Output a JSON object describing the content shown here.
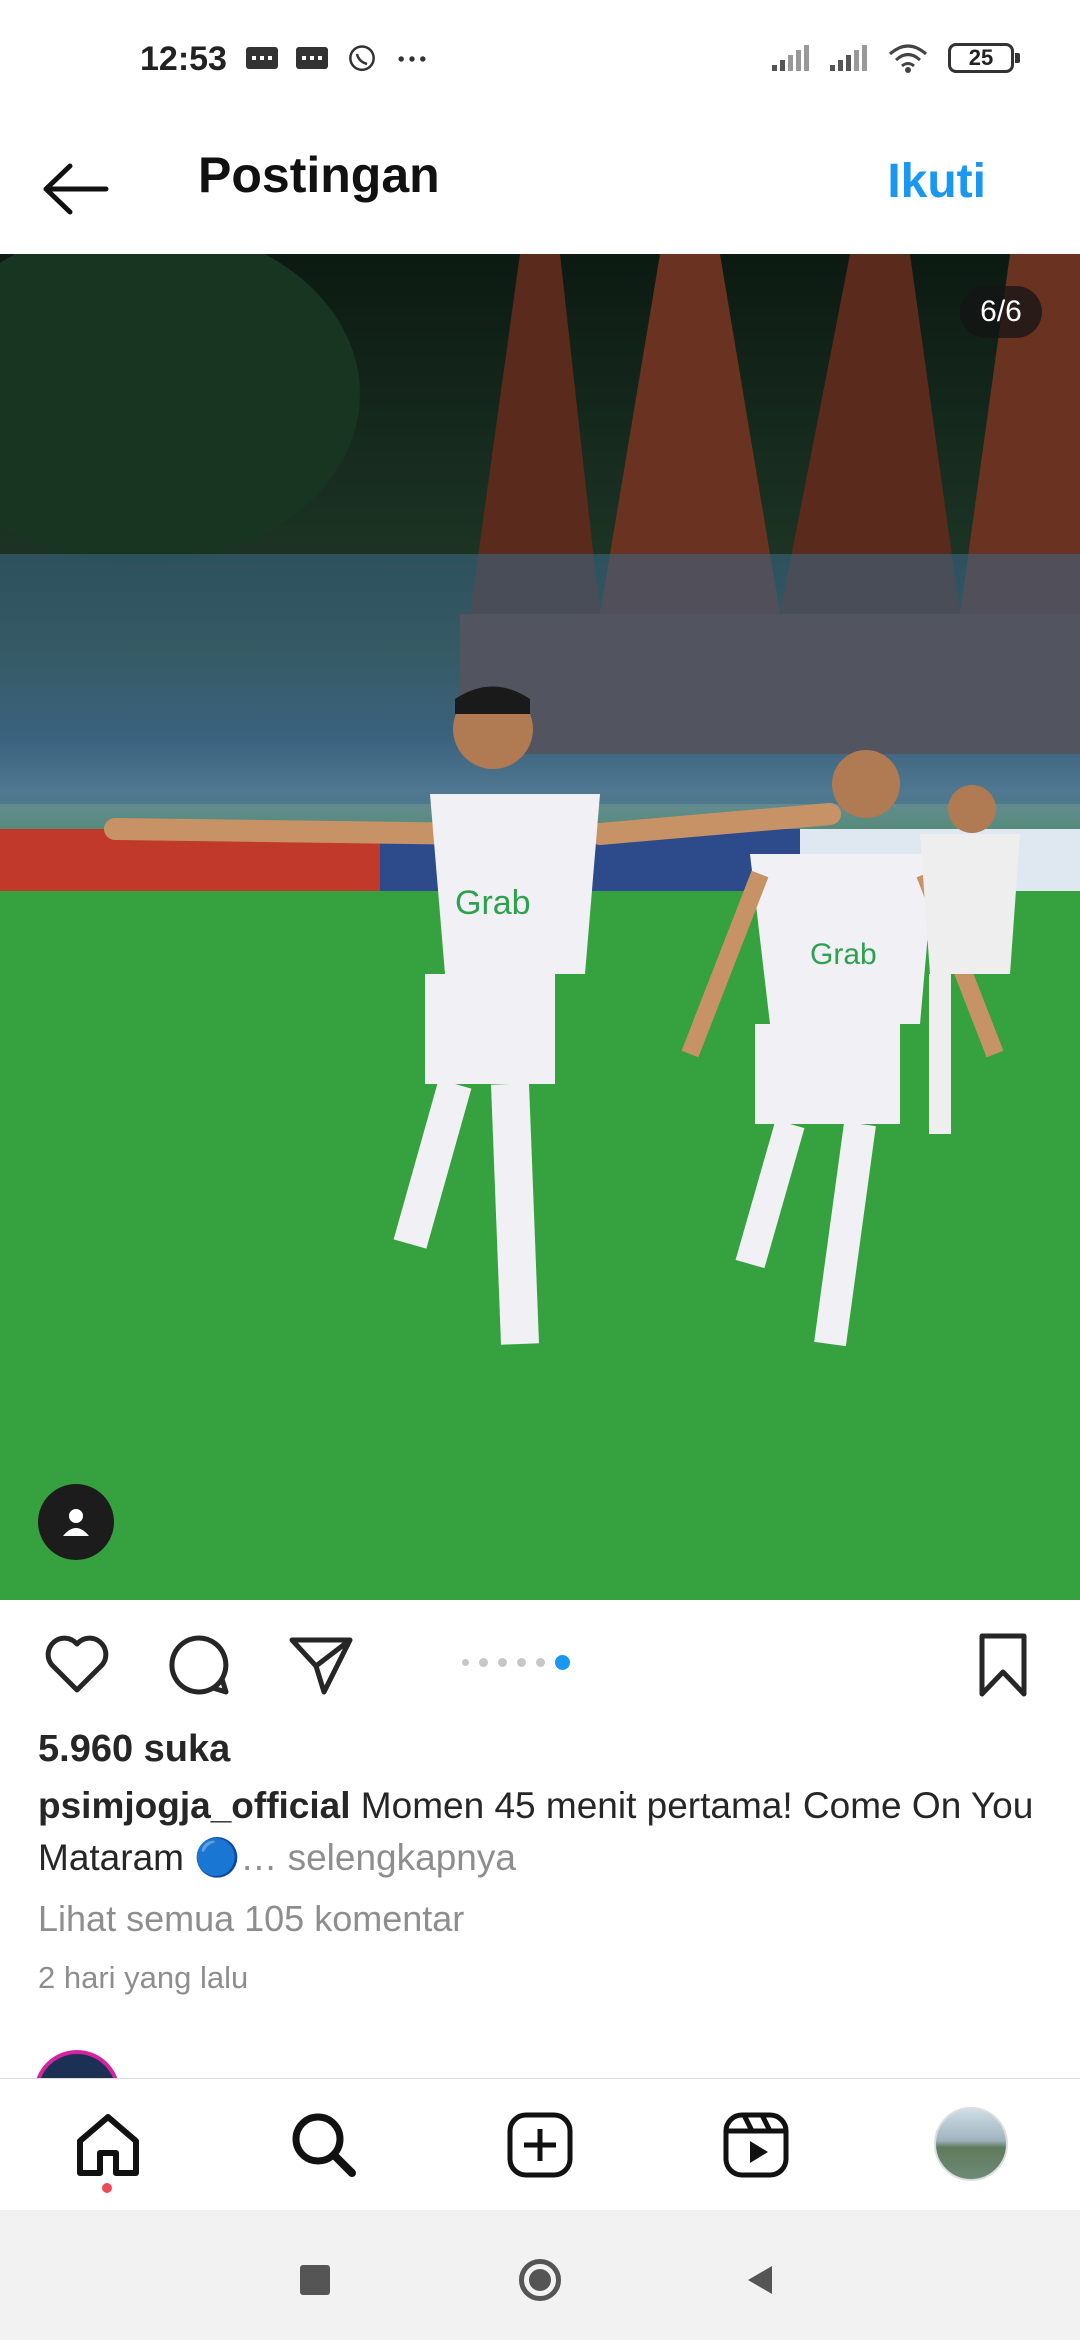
{
  "status_bar": {
    "time": "12:53",
    "battery": "25",
    "icons": [
      "message-icon",
      "message-icon",
      "whatsapp-icon",
      "more-dots-icon",
      "signal-icon",
      "signal-icon",
      "wifi-icon",
      "battery-icon"
    ]
  },
  "header": {
    "title": "Postingan",
    "follow_label": "Ikuti"
  },
  "post": {
    "image_counter": "6/6",
    "carousel": {
      "total": 6,
      "active_index": 5
    }
  },
  "actions": {
    "icons": [
      "heart-icon",
      "comment-icon",
      "share-icon",
      "bookmark-icon"
    ]
  },
  "details": {
    "likes": "5.960 suka",
    "username": "psimjogja_official",
    "caption_text": "Momen 45 menit pertama! Come On You Mataram 🔵",
    "more_label": "… selengkapnya",
    "comments_link": "Lihat semua 105 komentar",
    "timestamp": "2 hari yang lalu"
  },
  "bottom_nav": {
    "items": [
      "home-icon",
      "search-icon",
      "create-icon",
      "reels-icon",
      "profile-avatar"
    ]
  },
  "system_nav": {
    "items": [
      "recents-icon",
      "home-circle-icon",
      "back-triangle-icon"
    ]
  },
  "colors": {
    "accent": "#1a97f0",
    "notification": "#ed4956",
    "text": "#262626",
    "muted": "#8e8e8e"
  }
}
